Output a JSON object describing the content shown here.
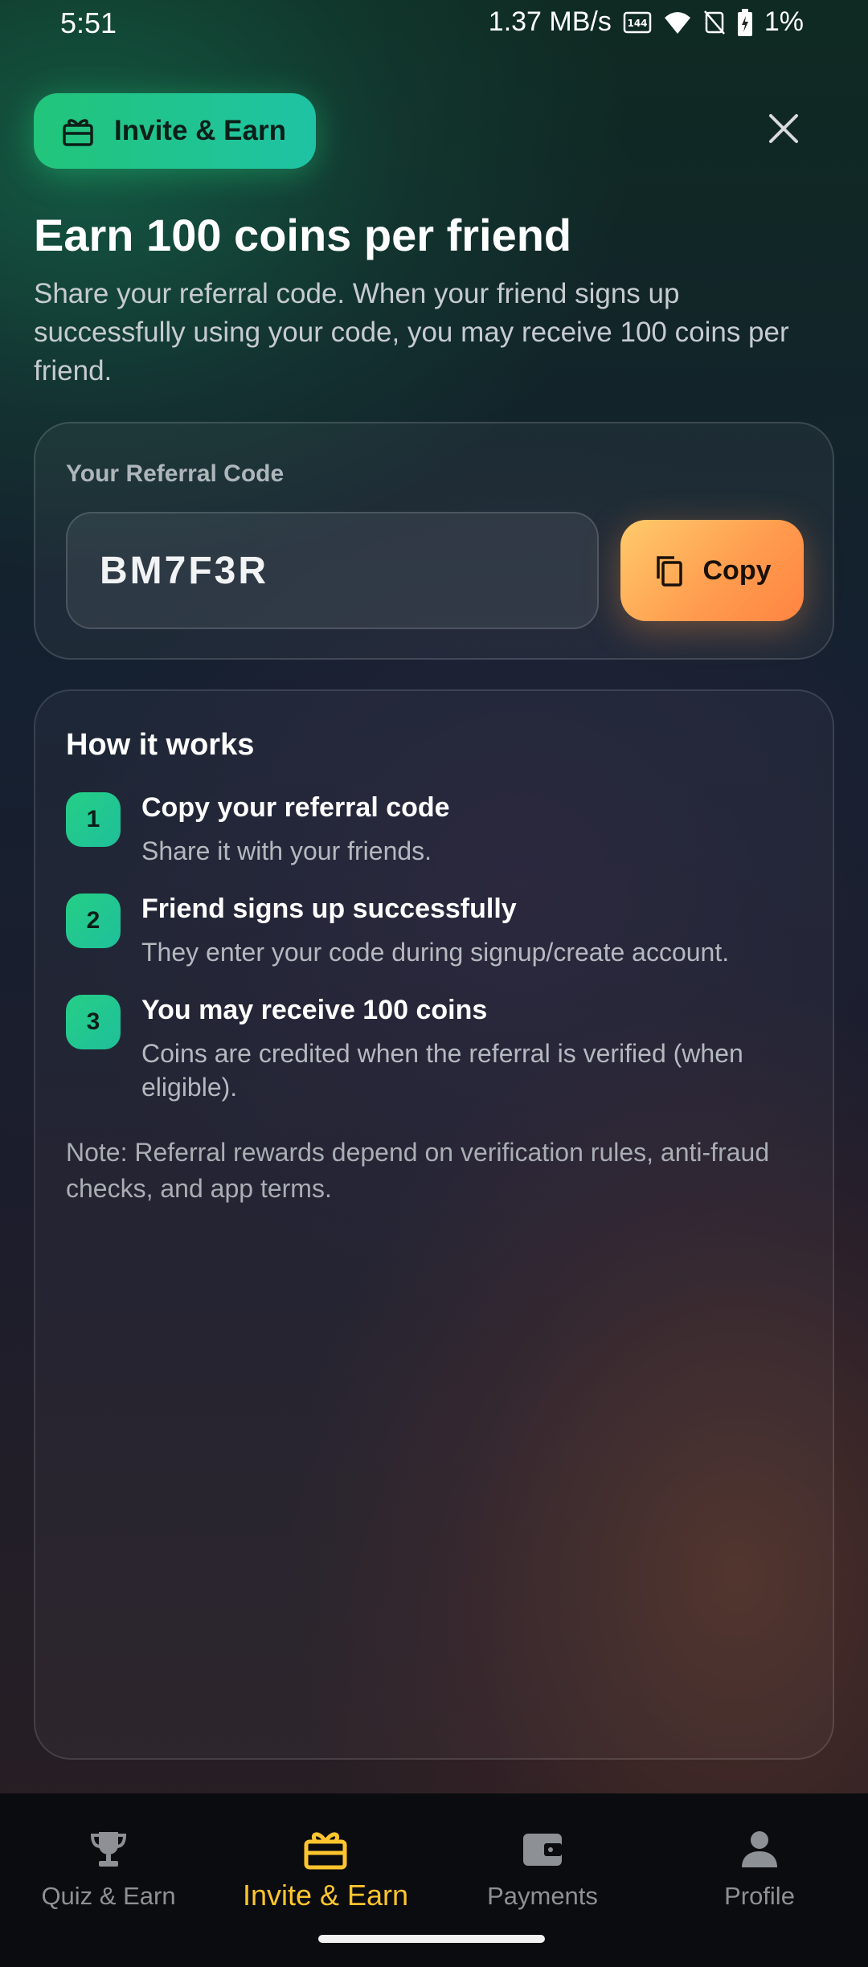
{
  "status_bar": {
    "time": "5:51",
    "network_speed": "1.37 MB/s",
    "battery": "1%",
    "icons": [
      "hd-icon",
      "wifi-icon",
      "silent-icon",
      "battery-charging-icon"
    ]
  },
  "header": {
    "chip_label": "Invite & Earn",
    "chip_icon": "gift-icon",
    "close_icon": "close-icon"
  },
  "intro": {
    "title": "Earn 100 coins per friend",
    "description": "Share your referral code. When your friend signs up successfully using your code, you may receive 100 coins per friend."
  },
  "referral": {
    "label": "Your Referral Code",
    "code": "BM7F3R",
    "copy_label": "Copy",
    "copy_icon": "copy-icon"
  },
  "how_it_works": {
    "title": "How it works",
    "steps": [
      {
        "number": "1",
        "title": "Copy your referral code",
        "description": "Share it with your friends."
      },
      {
        "number": "2",
        "title": "Friend signs up successfully",
        "description": "They enter your code during signup/create account."
      },
      {
        "number": "3",
        "title": "You may receive 100 coins",
        "description": "Coins are credited when the referral is verified (when eligible)."
      }
    ],
    "note": "Note: Referral rewards depend on verification rules, anti-fraud checks, and app terms."
  },
  "bottom_nav": {
    "active": "Invite & Earn",
    "items": [
      {
        "label": "Quiz & Earn",
        "icon": "trophy-icon"
      },
      {
        "label": "Invite & Earn",
        "icon": "gift-icon"
      },
      {
        "label": "Payments",
        "icon": "wallet-icon"
      },
      {
        "label": "Profile",
        "icon": "person-icon"
      }
    ]
  },
  "colors": {
    "accent_green": "#22c57a",
    "copy_orange": "#ff9a4d",
    "nav_active": "#ffc52e",
    "nav_inactive": "#8d9094"
  }
}
